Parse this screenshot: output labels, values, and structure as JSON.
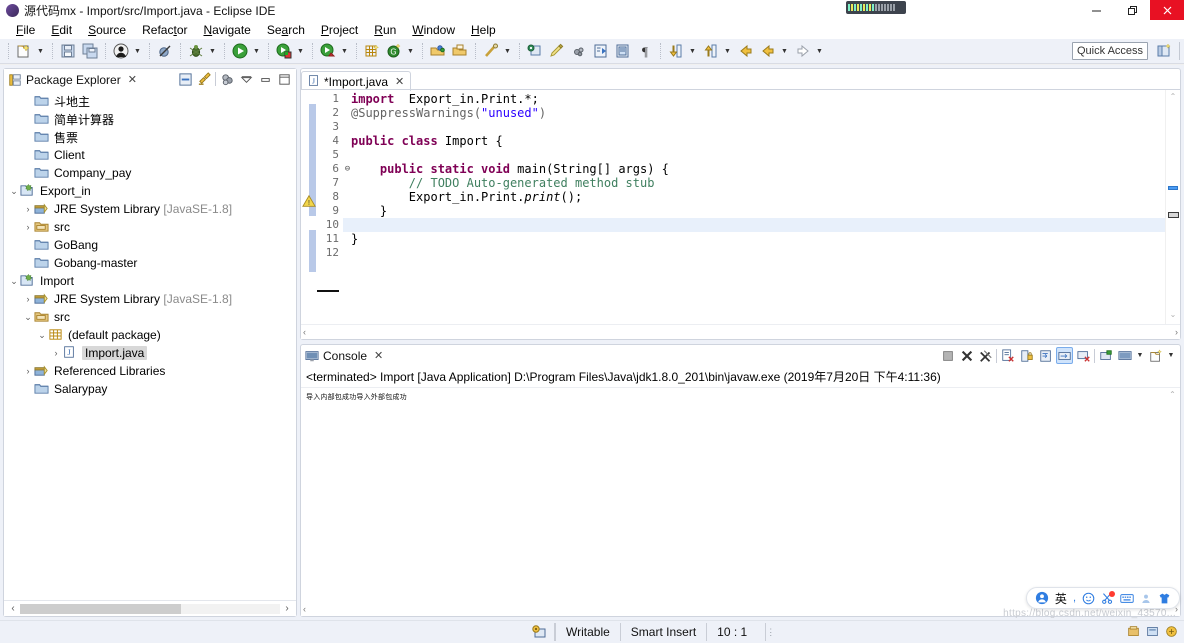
{
  "window": {
    "title": "源代码mx - Import/src/Import.java - Eclipse IDE",
    "app_icon": "eclipse-icon",
    "minimize": "–",
    "restore": "❐",
    "close": "✕"
  },
  "menubar": [
    {
      "label": "File",
      "mnemonic": "F"
    },
    {
      "label": "Edit",
      "mnemonic": "E"
    },
    {
      "label": "Source",
      "mnemonic": "S"
    },
    {
      "label": "Refactor",
      "mnemonic": "t"
    },
    {
      "label": "Navigate",
      "mnemonic": "N"
    },
    {
      "label": "Search",
      "mnemonic": "a"
    },
    {
      "label": "Project",
      "mnemonic": "P"
    },
    {
      "label": "Run",
      "mnemonic": "R"
    },
    {
      "label": "Window",
      "mnemonic": "W"
    },
    {
      "label": "Help",
      "mnemonic": "H"
    }
  ],
  "toolbar": {
    "quick_access_placeholder": "Quick Access",
    "buttons": [
      "new-wizard-icon",
      "save-icon",
      "save-all-icon",
      "person-icon",
      "toggle-breakpoint-icon",
      "debug-icon",
      "run-icon",
      "run-external-tool-icon",
      "coverage-icon",
      "new-java-project-icon",
      "new-annotation-icon",
      "open-type-icon",
      "open-task-icon",
      "search-icon",
      "open-in-window-icon",
      "pencil-icon",
      "spell-icon",
      "next-annotation-icon",
      "previous-annotation-icon",
      "pilcrow-icon",
      "down-arrow-icon",
      "up-arrow-icon",
      "back-icon",
      "forward-icon",
      "next-edit-icon"
    ]
  },
  "package_explorer": {
    "title": "Package Explorer",
    "tab_icon": "package-explorer-icon",
    "close_icon": "close-icon",
    "tools": [
      "collapse-all-icon",
      "link-with-editor-icon",
      "view-menu-icon",
      "minimize-icon",
      "maximize-icon"
    ],
    "tree": [
      {
        "label": "斗地主",
        "icon": "project-closed-icon",
        "indent": 1,
        "twist": "",
        "selected": false
      },
      {
        "label": "简单计算器",
        "icon": "project-closed-icon",
        "indent": 1,
        "twist": "",
        "selected": false
      },
      {
        "label": "售票",
        "icon": "project-closed-icon",
        "indent": 1,
        "twist": "",
        "selected": false
      },
      {
        "label": "Client",
        "icon": "project-closed-icon",
        "indent": 1,
        "twist": "",
        "selected": false
      },
      {
        "label": "Company_pay",
        "icon": "project-closed-icon",
        "indent": 1,
        "twist": "",
        "selected": false
      },
      {
        "label": "Export_in",
        "icon": "project-open-icon",
        "indent": 0,
        "twist": "expanded",
        "selected": false
      },
      {
        "label": "JRE System Library",
        "suffix": "[JavaSE-1.8]",
        "icon": "library-icon",
        "indent": 1,
        "twist": "collapsed",
        "selected": false
      },
      {
        "label": "src",
        "icon": "source-folder-icon",
        "indent": 1,
        "twist": "collapsed",
        "selected": false
      },
      {
        "label": "GoBang",
        "icon": "project-closed-icon",
        "indent": 1,
        "twist": "",
        "selected": false
      },
      {
        "label": "Gobang-master",
        "icon": "project-closed-icon",
        "indent": 1,
        "twist": "",
        "selected": false
      },
      {
        "label": "Import",
        "icon": "project-open-icon",
        "indent": 0,
        "twist": "expanded",
        "selected": false
      },
      {
        "label": "JRE System Library",
        "suffix": "[JavaSE-1.8]",
        "icon": "library-icon",
        "indent": 1,
        "twist": "collapsed",
        "selected": false
      },
      {
        "label": "src",
        "icon": "source-folder-icon",
        "indent": 1,
        "twist": "expanded",
        "selected": false
      },
      {
        "label": "(default package)",
        "icon": "package-icon",
        "indent": 2,
        "twist": "expanded",
        "selected": false
      },
      {
        "label": "Import.java",
        "icon": "java-file-icon",
        "indent": 3,
        "twist": "collapsed",
        "selected": true
      },
      {
        "label": "Referenced Libraries",
        "icon": "library-icon",
        "indent": 1,
        "twist": "collapsed",
        "selected": false
      },
      {
        "label": "Salarypay",
        "icon": "project-closed-icon",
        "indent": 1,
        "twist": "",
        "selected": false
      }
    ],
    "hscroll_left": "‹",
    "hscroll_right": "›"
  },
  "editor": {
    "tab_label": "*Import.java",
    "tab_icon": "java-file-icon",
    "close_icon": "close-icon",
    "current_line": 10,
    "lines": [
      {
        "n": "1",
        "fold": "",
        "tokens": [
          {
            "t": "import  ",
            "c": "kw"
          },
          {
            "t": "Export_in.Print.*;",
            "c": "plain"
          }
        ]
      },
      {
        "n": "2",
        "fold": "",
        "tokens": [
          {
            "t": "@SuppressWarnings(",
            "c": "ann"
          },
          {
            "t": "\"unused\"",
            "c": "str"
          },
          {
            "t": ")",
            "c": "ann"
          }
        ]
      },
      {
        "n": "3",
        "fold": "",
        "tokens": []
      },
      {
        "n": "4",
        "fold": "",
        "tokens": [
          {
            "t": "public class ",
            "c": "kw"
          },
          {
            "t": "Import {",
            "c": "plain"
          }
        ]
      },
      {
        "n": "5",
        "fold": "",
        "tokens": []
      },
      {
        "n": "6",
        "fold": "⊖",
        "tokens": [
          {
            "t": "    public static void ",
            "c": "kw"
          },
          {
            "t": "main(String[] args) {",
            "c": "plain"
          }
        ]
      },
      {
        "n": "7",
        "fold": "",
        "tokens": [
          {
            "t": "        // TODO Auto-generated method stub",
            "c": "cmt"
          }
        ]
      },
      {
        "n": "8",
        "fold": "",
        "tokens": [
          {
            "t": "        Export_in.Print.",
            "c": "plain"
          },
          {
            "t": "print",
            "c": "mth"
          },
          {
            "t": "();",
            "c": "plain"
          }
        ]
      },
      {
        "n": "9",
        "fold": "",
        "tokens": [
          {
            "t": "    }",
            "c": "plain"
          }
        ]
      },
      {
        "n": "10",
        "fold": "",
        "tokens": []
      },
      {
        "n": "11",
        "fold": "",
        "tokens": [
          {
            "t": "}",
            "c": "plain"
          }
        ]
      },
      {
        "n": "12",
        "fold": "",
        "tokens": []
      }
    ],
    "warning_marker": "warning-icon",
    "scroll_up": "⌃",
    "scroll_down": "⌄"
  },
  "console": {
    "title": "Console",
    "tab_icon": "console-icon",
    "close_icon": "close-icon",
    "header": "<terminated> Import [Java Application] D:\\Program Files\\Java\\jdk1.8.0_201\\bin\\javaw.exe (2019年7月20日 下午4:11:36)",
    "output": "导入内部包成功导入外部包成功",
    "tools": [
      "terminate-icon",
      "remove-launch-icon",
      "remove-all-terminated-icon",
      "clear-console-icon",
      "scroll-lock-icon",
      "word-wrap-icon",
      "show-console-icon",
      "pin-console-icon",
      "display-selected-console-icon",
      "open-console-icon",
      "new-console-view-icon"
    ]
  },
  "statusbar": {
    "writable": "Writable",
    "insert_mode": "Smart Insert",
    "position": "10 : 1",
    "icon": "build-status-icon"
  },
  "ime": {
    "logo_icon": "baidu-ime-icon",
    "mode": "英",
    "punctuation_icon": "punctuation-icon",
    "emoji_icon": "smiley-icon",
    "tools_icon": "scissors-icon",
    "keyboard_icon": "keyboard-icon",
    "user_icon": "person-icon",
    "skin_icon": "shirt-icon"
  },
  "watermark": "https://blog.csdn.net/weixin_43570...",
  "colors": {
    "accent": "#2f7de1",
    "keyword": "#7f0055",
    "string": "#2a00ff",
    "comment": "#3f7f5f",
    "annotation": "#646464",
    "current_line": "#e8f0fb",
    "panel_bg": "#eef1f8",
    "close_red": "#e81123"
  }
}
